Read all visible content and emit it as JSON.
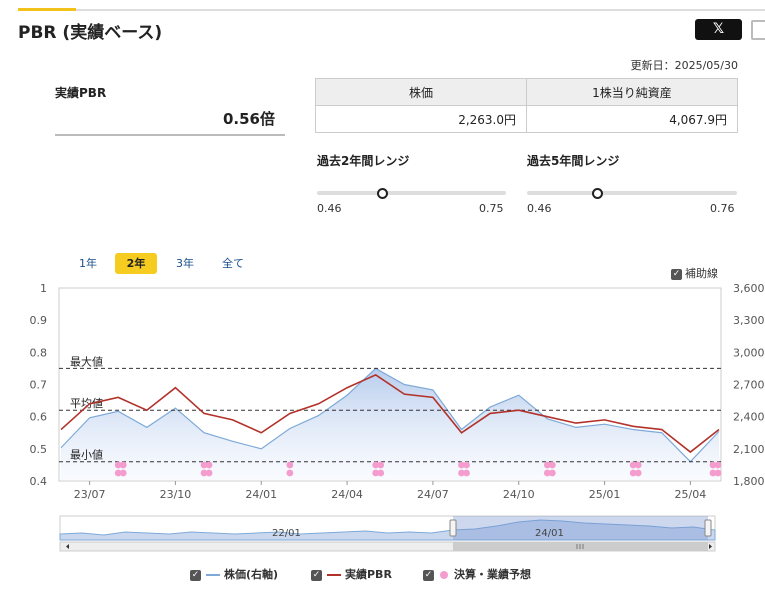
{
  "header": {
    "title": "PBR (実績ベース)",
    "share_label": "𝕏",
    "updated": "更新日：2025/05/30"
  },
  "summary": {
    "label": "実績PBR",
    "value": "0.56倍"
  },
  "info_table": {
    "headers": [
      "株価",
      "1株当り純資産"
    ],
    "values": [
      "2,263.0円",
      "4,067.9円"
    ]
  },
  "ranges": [
    {
      "title": "過去2年間レンジ",
      "min": "0.46",
      "max": "0.75",
      "current": 0.56
    },
    {
      "title": "過去5年間レンジ",
      "min": "0.46",
      "max": "0.76",
      "current": 0.56
    }
  ],
  "tabs": [
    "1年",
    "2年",
    "3年",
    "全て"
  ],
  "active_tab": "2年",
  "aux_label": "補助線",
  "legend": [
    "株価(右軸)",
    "実績PBR",
    "決算・業績予想"
  ],
  "colors": {
    "accent": "#f2c21b",
    "price": "#7ea9d8",
    "pbr": "#b2322a",
    "event": "#f39ccd"
  },
  "chart_data": {
    "type": "line",
    "y_left": {
      "min": 0.4,
      "max": 1.0,
      "ticks": [
        "0.4",
        "0.5",
        "0.6",
        "0.7",
        "0.8",
        "0.9",
        "1"
      ]
    },
    "y_right": {
      "min": 1800,
      "max": 3600,
      "ticks": [
        "1,800",
        "2,100",
        "2,400",
        "2,700",
        "3,000",
        "3,300",
        "3,600"
      ]
    },
    "x_ticks": [
      "23/07",
      "23/10",
      "24/01",
      "24/04",
      "24/07",
      "24/10",
      "25/01",
      "25/04"
    ],
    "reference_lines": [
      {
        "label": "最大値",
        "value": 0.75
      },
      {
        "label": "平均値",
        "value": 0.62
      },
      {
        "label": "最小値",
        "value": 0.46
      }
    ],
    "x": [
      "2023-06",
      "2023-07",
      "2023-08",
      "2023-09",
      "2023-10",
      "2023-11",
      "2023-12",
      "2024-01",
      "2024-02",
      "2024-03",
      "2024-04",
      "2024-05",
      "2024-06",
      "2024-07",
      "2024-08",
      "2024-09",
      "2024-10",
      "2024-11",
      "2024-12",
      "2025-01",
      "2025-02",
      "2025-03",
      "2025-04",
      "2025-05"
    ],
    "series": [
      {
        "name": "実績PBR",
        "axis": "left",
        "values": [
          0.56,
          0.64,
          0.66,
          0.62,
          0.69,
          0.61,
          0.59,
          0.55,
          0.61,
          0.64,
          0.69,
          0.73,
          0.67,
          0.66,
          0.55,
          0.61,
          0.62,
          0.6,
          0.58,
          0.59,
          0.57,
          0.56,
          0.49,
          0.56
        ]
      },
      {
        "name": "株価(右軸)",
        "axis": "right",
        "values": [
          2110,
          2390,
          2450,
          2300,
          2480,
          2250,
          2170,
          2100,
          2290,
          2410,
          2600,
          2850,
          2700,
          2650,
          2280,
          2490,
          2600,
          2380,
          2300,
          2330,
          2280,
          2250,
          1980,
          2263
        ]
      }
    ],
    "events": [
      "23/08",
      "23/08",
      "23/11",
      "23/11",
      "24/02",
      "24/05",
      "24/05",
      "24/08",
      "24/08",
      "24/11",
      "24/11",
      "25/02",
      "25/02",
      "25/05",
      "25/05"
    ],
    "navigator": {
      "labels": [
        "22/01",
        "24/01"
      ]
    }
  }
}
